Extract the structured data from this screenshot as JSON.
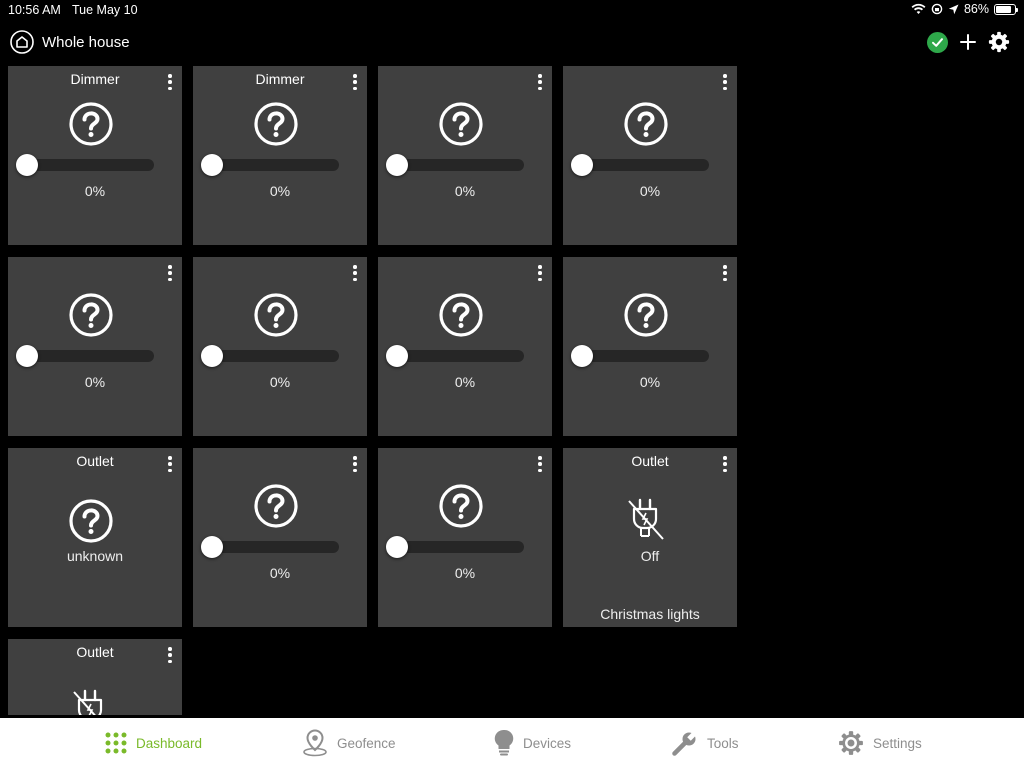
{
  "status_bar": {
    "time": "10:56 AM",
    "date": "Tue May 10",
    "battery": "86%",
    "battery_level": 0.86
  },
  "header": {
    "title": "Whole house"
  },
  "colors": {
    "accent": "#7aba2a",
    "connected": "#2ea84a",
    "tile_bg": "#404040",
    "background": "#000000"
  },
  "tiles": [
    {
      "title": "Dimmer",
      "value": "0%"
    },
    {
      "title": "Dimmer",
      "value": "0%"
    },
    {
      "title": "",
      "value": "0%"
    },
    {
      "title": "",
      "value": "0%"
    },
    {
      "title": "",
      "value": "0%"
    },
    {
      "title": "",
      "value": "0%"
    },
    {
      "title": "",
      "value": "0%"
    },
    {
      "title": "",
      "value": "0%"
    },
    {
      "title": "Outlet",
      "status": "unknown"
    },
    {
      "title": "",
      "value": "0%"
    },
    {
      "title": "",
      "value": "0%"
    },
    {
      "title": "Outlet",
      "status": "Off",
      "name": "Christmas lights"
    },
    {
      "title": "Outlet"
    }
  ],
  "tabs": [
    {
      "label": "Dashboard",
      "icon": "grid-icon",
      "active": true
    },
    {
      "label": "Geofence",
      "icon": "location-pin-icon",
      "active": false
    },
    {
      "label": "Devices",
      "icon": "lightbulb-icon",
      "active": false
    },
    {
      "label": "Tools",
      "icon": "wrench-icon",
      "active": false
    },
    {
      "label": "Settings",
      "icon": "gear-icon",
      "active": false
    }
  ]
}
